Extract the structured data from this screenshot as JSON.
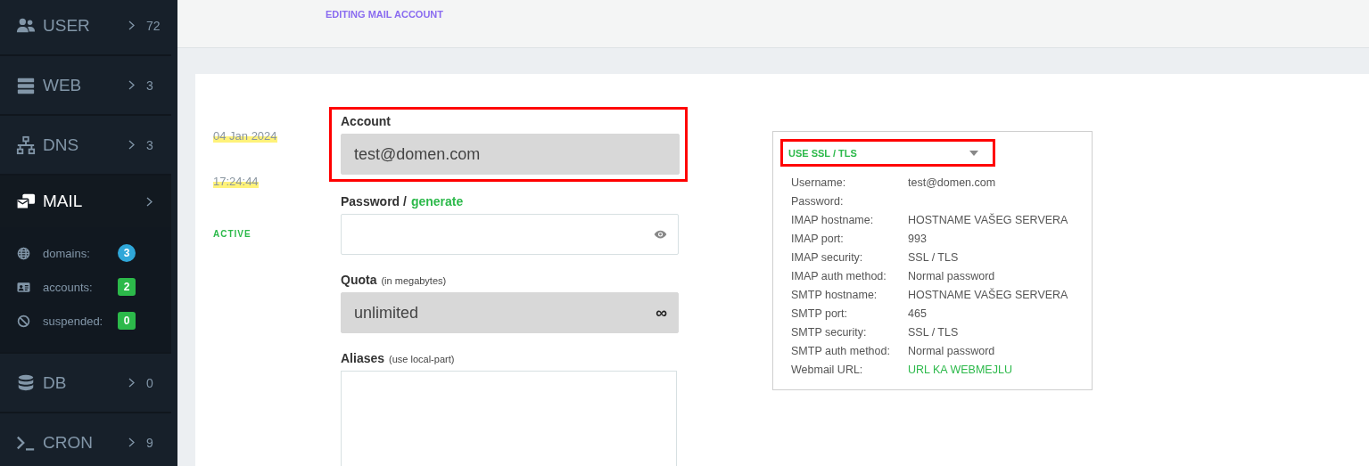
{
  "sidebar": {
    "items": [
      {
        "label": "USER",
        "count": "72",
        "selected": false
      },
      {
        "label": "WEB",
        "count": "3",
        "selected": false
      },
      {
        "label": "DNS",
        "count": "3",
        "selected": false
      },
      {
        "label": "MAIL",
        "selected": true,
        "expanded": true,
        "children": [
          {
            "label": "domains:",
            "badge": "3",
            "kind": "round",
            "color": "#2fa7d9"
          },
          {
            "label": "accounts:",
            "badge": "2",
            "kind": "square",
            "color": "#2cb94a"
          },
          {
            "label": "suspended:",
            "badge": "0",
            "kind": "square",
            "color": "#2cb94a"
          }
        ]
      },
      {
        "label": "DB",
        "count": "0",
        "selected": false
      },
      {
        "label": "CRON",
        "count": "9",
        "selected": false
      }
    ]
  },
  "page_title": "EDITING MAIL ACCOUNT",
  "meta": {
    "date": "04  Jan  2024",
    "time": "17:24:44",
    "status": "ACTIVE"
  },
  "form": {
    "account": {
      "label": "Account",
      "value": "test@domen.com",
      "disabled": true
    },
    "password": {
      "label": "Password /",
      "link": "generate"
    },
    "quota": {
      "label": "Quota",
      "hint": "(in megabytes)",
      "value": "unlimited",
      "suffix": "∞",
      "disabled": true
    },
    "aliases": {
      "label": "Aliases",
      "hint": "(use local-part)"
    }
  },
  "info": {
    "select": "USE SSL / TLS",
    "rows": [
      {
        "label": "Username:",
        "value": "test@domen.com"
      },
      {
        "label": "Password:"
      },
      {
        "label": "IMAP hostname:",
        "value": "HOSTNAME VAŠEG SERVERA"
      },
      {
        "label": "IMAP port:",
        "value": "993"
      },
      {
        "label": "IMAP security:",
        "value": "SSL / TLS"
      },
      {
        "label": "IMAP auth method:",
        "value": "Normal password"
      },
      {
        "label": "SMTP hostname:",
        "value": "HOSTNAME VAŠEG SERVERA"
      },
      {
        "label": "SMTP port:",
        "value": "465"
      },
      {
        "label": "SMTP security:",
        "value": "SSL / TLS"
      },
      {
        "label": "SMTP auth method:",
        "value": "Normal password"
      },
      {
        "label": "Webmail URL:",
        "value": "URL KA WEBMEJLU",
        "kind": "link"
      }
    ]
  }
}
